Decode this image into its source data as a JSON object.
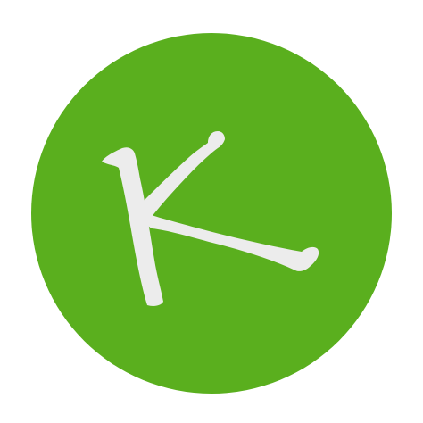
{
  "icon": {
    "name": "k-letter-logo-icon",
    "background_color": "#5aaf1e",
    "glyph_color": "#ececec",
    "letter": "K"
  }
}
